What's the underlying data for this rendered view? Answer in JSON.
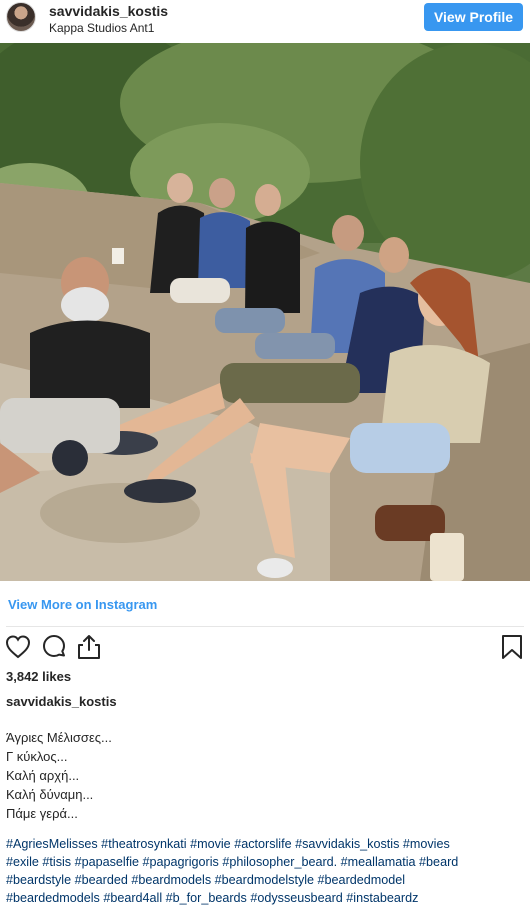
{
  "header": {
    "username": "savvidakis_kostis",
    "location": "Kappa Studios Ant1",
    "view_profile_label": "View Profile",
    "avatar_icon": "profile-avatar",
    "accent_color": "#3897f0"
  },
  "post": {
    "image_icon": "group-photo",
    "view_more_label": "View More on Instagram",
    "likes": "3,842 likes",
    "caption_username": "savvidakis_kostis",
    "caption_lines": [
      "Άγριες Μέλισσες...",
      "Γ κύκλος...",
      "Καλή αρχή...",
      "Καλή δύναμη...",
      "Πάμε γερά..."
    ],
    "hashtag_lines": [
      "#AgriesMelisses #theatrosynkati #movie #actorslife #savvidakis_kostis #movies",
      "#exile #tisis #papaselfie #papagrigoris #philosopher_beard. #meallamatia #beard",
      "#beardstyle #bearded #beardmodels #beardmodelstyle #beardedmodel",
      "#beardedmodels #beard4all #b_for_beards #odysseusbeard #instabeardz"
    ],
    "hashtag_color": "#003569"
  },
  "actions": {
    "like_icon": "heart-icon",
    "comment_icon": "comment-icon",
    "share_icon": "share-icon",
    "save_icon": "bookmark-icon"
  }
}
